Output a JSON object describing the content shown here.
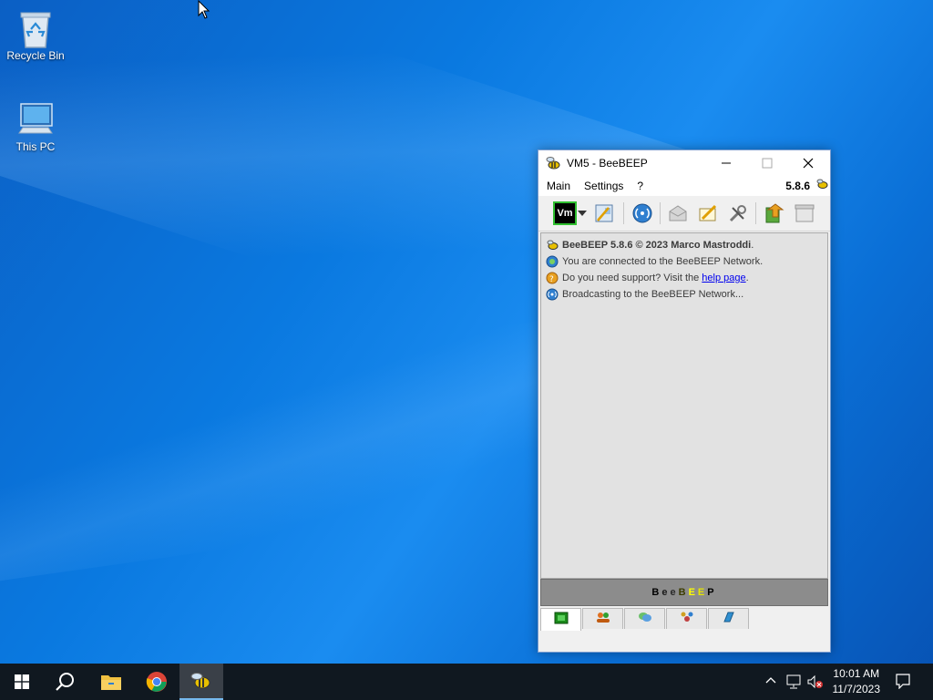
{
  "desktop": {
    "icons": [
      {
        "label": "Recycle Bin"
      },
      {
        "label": "This PC"
      }
    ]
  },
  "window": {
    "title": "VM5 - BeeBEEP",
    "menu": [
      "Main",
      "Settings",
      "?"
    ],
    "version": "5.8.6",
    "toolbar_status_tag": "Vm",
    "chat_lines": [
      {
        "icon": "bee-icon",
        "text": "BeeBEEP 5.8.6 © 2023 Marco Mastroddi",
        "suffix": "."
      },
      {
        "icon": "connected-icon",
        "text": "You are connected to the BeeBEEP Network."
      },
      {
        "icon": "help-icon",
        "text": "Do you need support? Visit the ",
        "link": "help page",
        "suffix": "."
      },
      {
        "icon": "broadcast-icon",
        "text": "Broadcasting to the BeeBEEP Network..."
      }
    ],
    "banner_letters": [
      "B",
      "e",
      "e",
      "B",
      "E",
      "E",
      "P"
    ],
    "banner_colors": [
      "#000000",
      "#1a1a1a",
      "#2a2a2a",
      "#3c3c00",
      "#ffff00",
      "#e6e600",
      "#000000"
    ]
  },
  "taskbar": {
    "time": "10:01 AM",
    "date": "11/7/2023"
  },
  "colors": {
    "accent": "#76b9ed",
    "taskbar": "#101820",
    "link": "#0000ee"
  }
}
